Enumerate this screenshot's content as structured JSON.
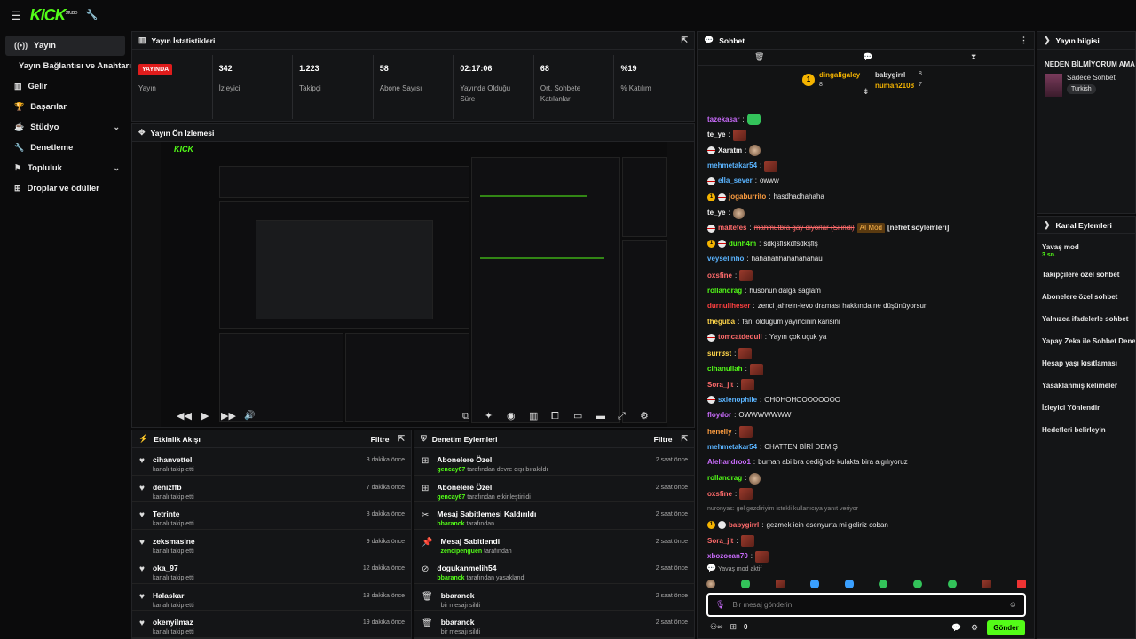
{
  "topbar": {
    "logo": "KICK",
    "logo_sup": "STUDIO"
  },
  "sidebar": {
    "items": [
      {
        "label": "Yayın",
        "icon": "broadcast-icon"
      },
      {
        "label": "Yayın Bağlantısı ve Anahtarı"
      },
      {
        "label": "Gelir",
        "icon": "chart-icon"
      },
      {
        "label": "Başarılar",
        "icon": "trophy-icon"
      },
      {
        "label": "Stüdyo",
        "icon": "studio-icon"
      },
      {
        "label": "Denetleme",
        "icon": "wrench-icon"
      },
      {
        "label": "Topluluk",
        "icon": "community-icon"
      },
      {
        "label": "Droplar ve ödüller",
        "icon": "gift-icon"
      }
    ]
  },
  "stats": {
    "title": "Yayın İstatistikleri",
    "live_label": "YAYINDA",
    "live_sub": "Yayın",
    "items": [
      {
        "value": "342",
        "label": "İzleyici"
      },
      {
        "value": "1.223",
        "label": "Takipçi"
      },
      {
        "value": "58",
        "label": "Abone Sayısı"
      },
      {
        "value": "02:17:06",
        "label": "Yayında Olduğu Süre"
      },
      {
        "value": "68",
        "label": "Ort. Sohbete Katılanlar"
      },
      {
        "value": "%19",
        "label": "% Katılım"
      }
    ]
  },
  "preview": {
    "title": "Yayın Ön İzlemesi"
  },
  "activity": {
    "title": "Etkinlik Akışı",
    "filter": "Filtre",
    "rows": [
      {
        "name": "cihanvettel",
        "sub": "kanalı takip etti",
        "time": "3 dakika önce"
      },
      {
        "name": "denizffb",
        "sub": "kanalı takip etti",
        "time": "7 dakika önce"
      },
      {
        "name": "Tetrinte",
        "sub": "kanalı takip etti",
        "time": "8 dakika önce"
      },
      {
        "name": "zeksmasine",
        "sub": "kanalı takip etti",
        "time": "9 dakika önce"
      },
      {
        "name": "oka_97",
        "sub": "kanalı takip etti",
        "time": "12 dakika önce"
      },
      {
        "name": "Halaskar",
        "sub": "kanalı takip etti",
        "time": "18 dakika önce"
      },
      {
        "name": "okenyilmaz",
        "sub": "kanalı takip etti",
        "time": "19 dakika önce"
      }
    ]
  },
  "moderation": {
    "title": "Denetim Eylemleri",
    "filter": "Filtre",
    "rows": [
      {
        "name": "Abonelere Özel",
        "user": "gencay67",
        "sub": "tarafından devre dışı bırakıldı",
        "time": "2 saat önce",
        "icon": "gift-icon"
      },
      {
        "name": "Abonelere Özel",
        "user": "gencay67",
        "sub": "tarafından etkinleştirildi",
        "time": "2 saat önce",
        "icon": "gift-icon"
      },
      {
        "name": "Mesaj Sabitlemesi Kaldırıldı",
        "user": "bbaranck",
        "sub": "tarafından",
        "time": "2 saat önce",
        "icon": "unpin-icon"
      },
      {
        "name": "Mesaj Sabitlendi",
        "user": "zencipenguen",
        "sub": "tarafından",
        "time": "2 saat önce",
        "icon": "pin-icon"
      },
      {
        "name": "dogukanmelih54",
        "user": "bbaranck",
        "sub": "tarafından yasaklandı",
        "time": "2 saat önce",
        "icon": "ban-icon"
      },
      {
        "name": "bbaranck",
        "user": "",
        "sub": "bir mesajı sildi",
        "time": "2 saat önce",
        "icon": "trash-icon"
      },
      {
        "name": "bbaranck",
        "user": "",
        "sub": "bir mesajı sildi",
        "time": "2 saat önce",
        "icon": "trash-icon"
      }
    ]
  },
  "chat": {
    "title": "Sohbet",
    "top": {
      "first": "dingaligaley",
      "first_count": "8",
      "second": "babygirrl",
      "second_count": "8",
      "third": "numan2108",
      "third_count": "7"
    },
    "messages": [
      {
        "user": "tazekasar",
        "color": "#c86bfa",
        "text": "",
        "emote": "g"
      },
      {
        "user": "te_ye",
        "color": "#f2f2f2",
        "text": "",
        "emote": "e"
      },
      {
        "user": "Xaratm",
        "color": "#f2f2f2",
        "text": "",
        "emote": "face",
        "badge": true
      },
      {
        "user": "mehmetakar54",
        "color": "#5ab4ff",
        "text": "",
        "emote": "e"
      },
      {
        "user": "ella_sever",
        "color": "#5ab4ff",
        "text": "owww",
        "badge": true
      },
      {
        "user": "jogaburrito",
        "color": "#ff9e40",
        "text": "hasdhadhahaha",
        "badge": true,
        "sub": true
      },
      {
        "user": "te_ye",
        "color": "#f2f2f2",
        "text": "",
        "emote": "face"
      },
      {
        "user": "maltefes",
        "color": "#ff6b6b",
        "text": "mahmutbra gay diyorlar (Silindi)",
        "tag": "AI Mod",
        "after": "[nefret söylemleri]",
        "badge": true
      },
      {
        "user": "dunh4m",
        "color": "#53fc18",
        "text": "sdkjsflskdfsdkşflş",
        "badge": true,
        "sub": true
      },
      {
        "user": "veyselinho",
        "color": "#5ab4ff",
        "text": "hahahahhahahahahaü"
      },
      {
        "user": "oxsfine",
        "color": "#ff6b6b",
        "text": "",
        "emote": "e"
      },
      {
        "user": "rollandrag",
        "color": "#53fc18",
        "text": "hüsonun dalga sağlam"
      },
      {
        "user": "durnullheser",
        "color": "#ff4040",
        "text": "zenci jahrein-levo draması hakkında ne düşünüyorsun"
      },
      {
        "user": "theguba",
        "color": "#ffd54a",
        "text": "fani oldugum yayincinin karisini"
      },
      {
        "user": "tomcatdedull",
        "color": "#ff6b6b",
        "text": "Yayın çok uçuk ya",
        "badge": true
      },
      {
        "user": "surr3st",
        "color": "#ffd54a",
        "text": "",
        "emote": "e"
      },
      {
        "user": "cihanullah",
        "color": "#53fc18",
        "text": "",
        "emote": "e"
      },
      {
        "user": "Sora_jit",
        "color": "#ff6b6b",
        "text": "",
        "emote": "e"
      },
      {
        "user": "sxlenophile",
        "color": "#5ab4ff",
        "text": "OHOHOHOOOOOOOO",
        "badge": true
      },
      {
        "user": "floydor",
        "color": "#c86bfa",
        "text": "OWWWWWWW"
      },
      {
        "user": "henelly",
        "color": "#ff9e40",
        "text": "",
        "emote": "e"
      },
      {
        "user": "mehmetakar54",
        "color": "#5ab4ff",
        "text": "CHATTEN BİRİ DEMİŞ"
      },
      {
        "user": "Alehandroo1",
        "color": "#c86bfa",
        "text": "burhan abi bra dediğnde kulakta bira algılıyoruz"
      },
      {
        "user": "rollandrag",
        "color": "#53fc18",
        "text": "",
        "emote": "face"
      },
      {
        "user": "oxsfine",
        "color": "#ff6b6b",
        "text": "",
        "emote": "e"
      },
      {
        "user": "",
        "color": "#888",
        "text": "nuronyas: gel gezdiriyim istekli kullanıcıya yanıt veriyor",
        "reply": true
      },
      {
        "user": "babygirrl",
        "color": "#ff6b6b",
        "text": "gezmek icin esenyurta mi geliriz coban",
        "badge": true,
        "sub": true
      },
      {
        "user": "Sora_jit",
        "color": "#ff6b6b",
        "text": "",
        "emote": "e"
      },
      {
        "user": "xbozocan70",
        "color": "#c86bfa",
        "text": "",
        "emote": "e"
      }
    ],
    "slow": "Yavaş mod aktif",
    "input_placeholder": "Bir mesaj gönderin",
    "count": "0",
    "send": "Gönder"
  },
  "info": {
    "title": "Yayın bilgisi",
    "stream_title": "NEDEN BİLMİYORUM AMA",
    "category": "Sadece Sohbet",
    "tag": "Turkish"
  },
  "channel": {
    "title": "Kanal Eylemleri",
    "slow_label": "Yavaş mod",
    "slow_value": "3 sn.",
    "items": [
      "Takipçilere özel sohbet",
      "Abonelere özel sohbet",
      "Yalnızca ifadelerle sohbet",
      "Yapay Zeka ile Sohbet Denetimi",
      "Hesap yaşı kısıtlaması",
      "Yasaklanmış kelimeler",
      "İzleyici Yönlendir",
      "Hedefleri belirleyin"
    ]
  },
  "colors": {
    "accent": "#53fc18",
    "live": "#e01c1c",
    "panel": "#141517"
  }
}
